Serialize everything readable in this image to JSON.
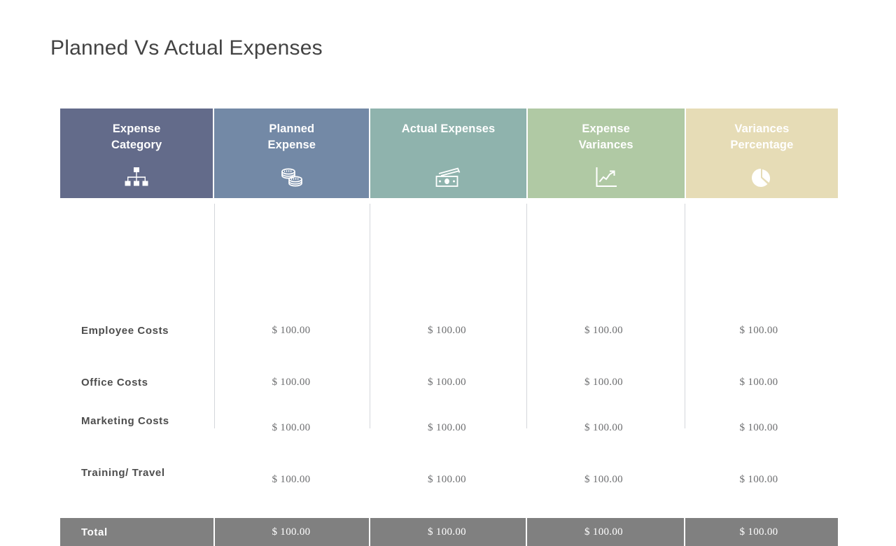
{
  "slide": {
    "title": "Planned Vs Actual Expenses"
  },
  "colors": {
    "header_expense_category": "#636b8a",
    "header_planned_expense": "#7389a6",
    "header_actual_expenses": "#8fb3ad",
    "header_expense_variances": "#b0c9a4",
    "header_variances_percentage": "#e6dcb6",
    "total_row_background": "#808080",
    "title_text": "#434343",
    "cell_text": "#6d6e70",
    "label_text": "#4d4d4d",
    "divider": "#d4d6db"
  },
  "table": {
    "columns": [
      {
        "label": "Expense\nCategory",
        "icon": "org-chart-icon",
        "bg": "#636b8a"
      },
      {
        "label": "Planned\nExpense",
        "icon": "coin-stack-icon",
        "bg": "#7389a6"
      },
      {
        "label": "Actual Expenses",
        "icon": "banknote-icon",
        "bg": "#8fb3ad"
      },
      {
        "label": "Expense\nVariances",
        "icon": "line-chart-icon",
        "bg": "#b0c9a4"
      },
      {
        "label": "Variances\nPercentage",
        "icon": "pie-chart-icon",
        "bg": "#e6dcb6"
      }
    ],
    "rows": [
      {
        "label": "Employee Costs",
        "values": [
          "$ 100.00",
          "$ 100.00",
          "$ 100.00",
          "$ 100.00"
        ]
      },
      {
        "label": "Office Costs",
        "values": [
          "$ 100.00",
          "$ 100.00",
          "$ 100.00",
          "$ 100.00"
        ]
      },
      {
        "label": "Marketing Costs",
        "values": [
          "$ 100.00",
          "$ 100.00",
          "$ 100.00",
          "$ 100.00"
        ]
      },
      {
        "label": "Training/ Travel",
        "values": [
          "$ 100.00",
          "$ 100.00",
          "$ 100.00",
          "$ 100.00"
        ]
      }
    ],
    "total": {
      "label": "Total",
      "values": [
        "$ 100.00",
        "$ 100.00",
        "$ 100.00",
        "$ 100.00"
      ]
    }
  }
}
